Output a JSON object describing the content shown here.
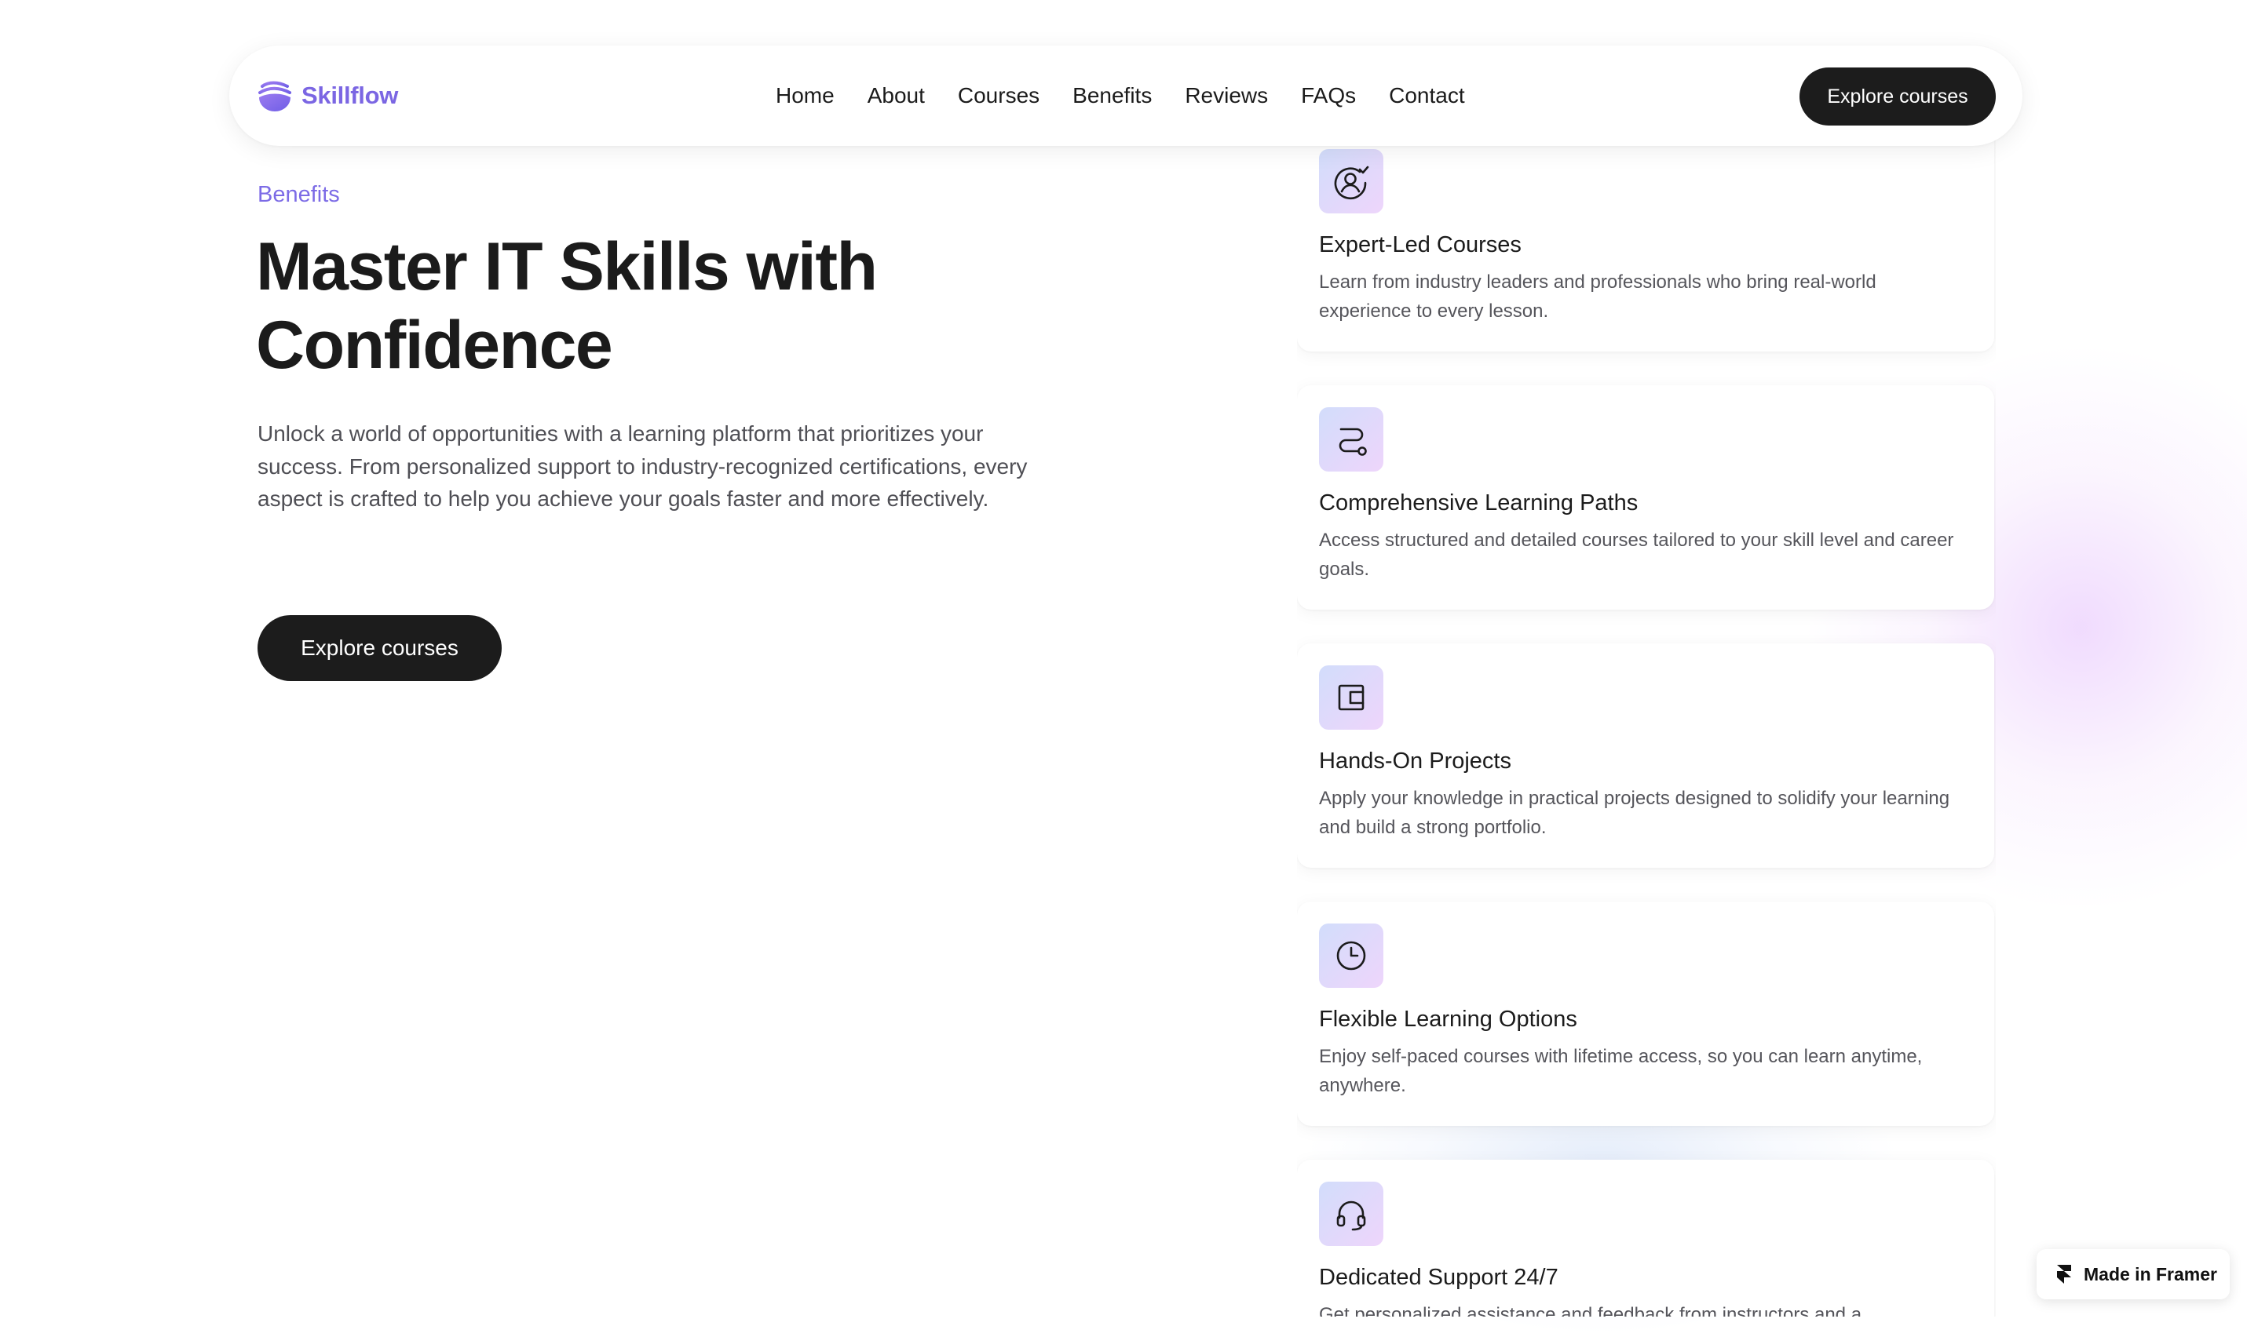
{
  "brand": {
    "name": "Skillflow",
    "accent": "#7b66e3"
  },
  "nav": {
    "links": [
      "Home",
      "About",
      "Courses",
      "Benefits",
      "Reviews",
      "FAQs",
      "Contact"
    ],
    "cta": "Explore courses"
  },
  "hero": {
    "eyebrow": "Benefits",
    "title_line1": "Master IT Skills with",
    "title_line2": "Confidence",
    "subtitle": "Unlock a world of opportunities with a learning platform that prioritizes your success. From personalized support to industry-recognized certifications, every aspect is crafted to help you achieve your goals faster and more effectively.",
    "cta": "Explore courses"
  },
  "benefits": [
    {
      "icon": "user-check-icon",
      "title": "Expert-Led Courses",
      "description": "Learn from industry leaders and professionals who bring real-world experience to every lesson."
    },
    {
      "icon": "route-icon",
      "title": "Comprehensive Learning Paths",
      "description": "Access structured and detailed courses tailored to your skill level and career goals."
    },
    {
      "icon": "project-frame-icon",
      "title": "Hands-On Projects",
      "description": "Apply your knowledge in practical projects designed to solidify your learning and build a strong portfolio."
    },
    {
      "icon": "clock-icon",
      "title": "Flexible Learning Options",
      "description": "Enjoy self-paced courses with lifetime access, so you can learn anytime, anywhere."
    },
    {
      "icon": "headset-icon",
      "title": "Dedicated Support 24/7",
      "description": "Get personalized assistance and feedback from instructors and a"
    }
  ],
  "badge": {
    "label": "Made in Framer"
  },
  "colors": {
    "dark_button": "#1c1c1c",
    "eyebrow": "#7c6be6",
    "icon_gradient_start": "#d2ddfb",
    "icon_gradient_end": "#eed5fb"
  }
}
